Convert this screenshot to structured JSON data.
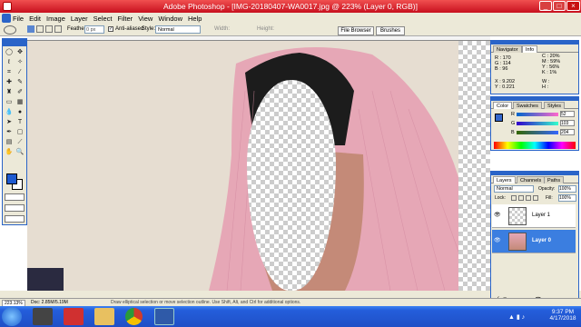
{
  "window": {
    "title": "Adobe Photoshop - [IMG-20180407-WA0017.jpg @ 223% (Layer 0, RGB)]"
  },
  "menu": [
    "File",
    "Edit",
    "Image",
    "Layer",
    "Select",
    "Filter",
    "View",
    "Window",
    "Help"
  ],
  "options": {
    "feather_label": "Feather:",
    "feather_value": "0 px",
    "antialiased_label": "Anti-aliased",
    "style_label": "Style:",
    "style_value": "Normal",
    "width_label": "Width:",
    "height_label": "Height:",
    "file_browser_tab": "File Browser",
    "brushes_tab": "Brushes"
  },
  "navigator": {
    "tabs": [
      "Navigator",
      "Info"
    ],
    "r_label": "R :",
    "r_value": "170",
    "g_label": "G :",
    "g_value": "114",
    "b_label": "B :",
    "b_value": "96",
    "c_label": "C :",
    "c_value": "20%",
    "m_label": "M :",
    "m_value": "59%",
    "y_label": "Y :",
    "y_value": "56%",
    "k_label": "K :",
    "k_value": "1%",
    "x_label": "X :",
    "x_value": "9.202",
    "y2_label": "Y :",
    "y2_value": "0.221",
    "w_label": "W :",
    "h_label": "H :"
  },
  "color_panel": {
    "tabs": [
      "Color",
      "Swatches",
      "Styles"
    ],
    "r_label": "R",
    "r_value": "52",
    "g_label": "G",
    "g_value": "103",
    "b_label": "B",
    "b_value": "204"
  },
  "layers_panel": {
    "tabs": [
      "Layers",
      "Channels",
      "Paths"
    ],
    "blend_mode": "Normal",
    "opacity_label": "Opacity:",
    "opacity_value": "100%",
    "lock_label": "Lock:",
    "fill_label": "Fill:",
    "fill_value": "100%",
    "layers": [
      {
        "name": "Layer 1",
        "selected": false
      },
      {
        "name": "Layer 0",
        "selected": true
      }
    ]
  },
  "status": {
    "zoom": "223.13%",
    "doc": "Doc: 2.85M/5.19M",
    "hint": "Draw elliptical selection or move selection outline. Use Shift, Alt, and Ctrl for additional options."
  },
  "taskbar": {
    "time": "9:37 PM",
    "date": "4/17/2018"
  },
  "colors": {
    "accent": "#2a64c8",
    "foreground": "#1e5ad0",
    "title_red": "#d42a2a"
  }
}
